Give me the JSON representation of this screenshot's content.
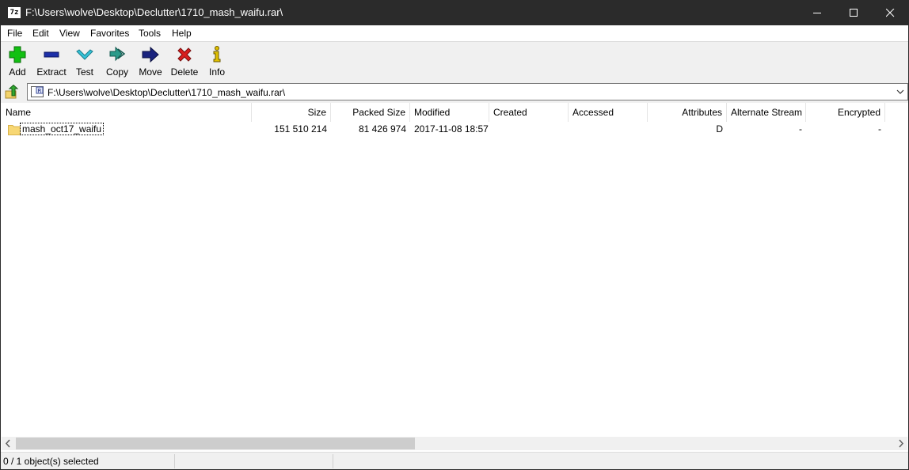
{
  "window": {
    "title": "F:\\Users\\wolve\\Desktop\\Declutter\\1710_mash_waifu.rar\\",
    "app_icon_text": "7z"
  },
  "menu": {
    "items": [
      "File",
      "Edit",
      "View",
      "Favorites",
      "Tools",
      "Help"
    ]
  },
  "toolbar": {
    "buttons": [
      {
        "label": "Add",
        "icon": "plus-icon",
        "color": "#12c012"
      },
      {
        "label": "Extract",
        "icon": "minus-icon",
        "color": "#1c2fa8"
      },
      {
        "label": "Test",
        "icon": "check-icon",
        "color": "#35c3d8"
      },
      {
        "label": "Copy",
        "icon": "double-arrow-icon",
        "color": "#2b9b8a"
      },
      {
        "label": "Move",
        "icon": "arrow-right-icon",
        "color": "#1a237e"
      },
      {
        "label": "Delete",
        "icon": "x-icon",
        "color": "#d81e1e"
      },
      {
        "label": "Info",
        "icon": "info-icon",
        "color": "#e0c000"
      }
    ]
  },
  "address": {
    "path": "F:\\Users\\wolve\\Desktop\\Declutter\\1710_mash_waifu.rar\\"
  },
  "list": {
    "columns": [
      "Name",
      "Size",
      "Packed Size",
      "Modified",
      "Created",
      "Accessed",
      "Attributes",
      "Alternate Stream",
      "Encrypted"
    ],
    "rows": [
      {
        "name": "mash_oct17_waifu",
        "size": "151 510 214",
        "packed_size": "81 426 974",
        "modified": "2017-11-08 18:57",
        "created": "",
        "accessed": "",
        "attributes": "D",
        "alternate_stream": "-",
        "encrypted": "-"
      }
    ]
  },
  "status": {
    "selection": "0 / 1 object(s) selected",
    "pane2": "",
    "pane3": ""
  }
}
